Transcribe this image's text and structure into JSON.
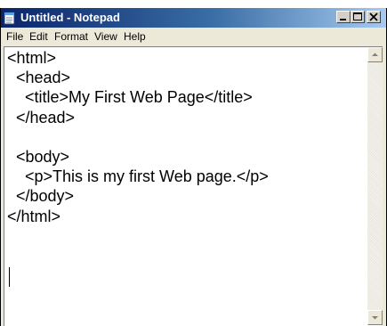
{
  "background_fragment": "",
  "window": {
    "title": "Untitled - Notepad",
    "app_icon": "notepad-icon",
    "controls": [
      "minimize-icon",
      "maximize-icon",
      "close-icon"
    ],
    "titlebar_colors": {
      "left": "#0a246a",
      "right": "#a6caf0"
    }
  },
  "menu": {
    "items": [
      {
        "label": "File"
      },
      {
        "label": "Edit"
      },
      {
        "label": "Format"
      },
      {
        "label": "View"
      },
      {
        "label": "Help"
      }
    ]
  },
  "editor": {
    "lines": [
      "<html>",
      "  <head>",
      "    <title>My First Web Page</title>",
      "  </head>",
      "",
      "  <body>",
      "    <p>This is my first Web page.</p>",
      "  </body>",
      "</html>",
      ""
    ]
  },
  "scrollbar": {
    "up_icon": "scroll-up-arrow-icon",
    "down_icon": "scroll-down-arrow-icon"
  }
}
